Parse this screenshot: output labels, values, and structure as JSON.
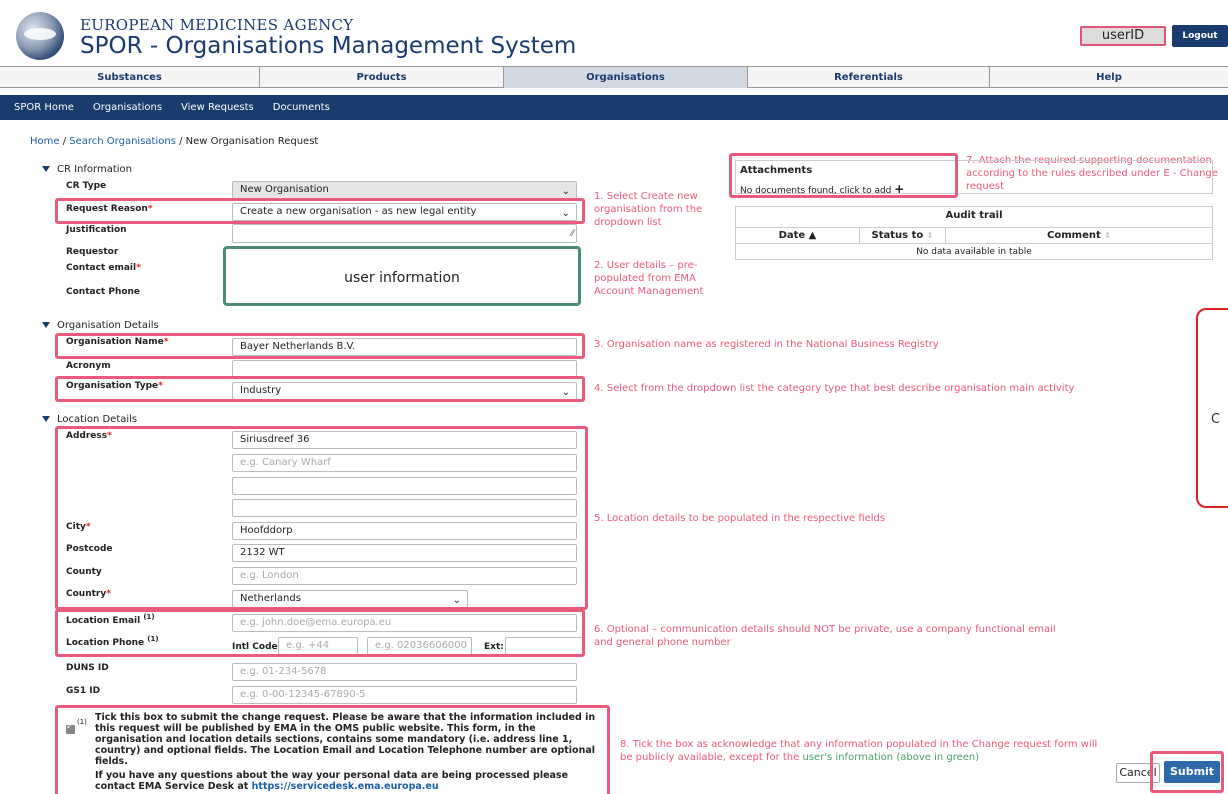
{
  "header": {
    "agency": "EUROPEAN MEDICINES AGENCY",
    "title": "SPOR - Organisations Management System",
    "user_id": "userID",
    "logout": "Logout"
  },
  "tabs": [
    "Substances",
    "Products",
    "Organisations",
    "Referentials",
    "Help"
  ],
  "active_tab": "Organisations",
  "nav": [
    "SPOR Home",
    "Organisations",
    "View Requests",
    "Documents"
  ],
  "breadcrumb": {
    "home": "Home",
    "sep": " / ",
    "search": "Search Organisations",
    "current": "New Organisation Request"
  },
  "cr_information": {
    "heading": "CR Information",
    "cr_type_label": "CR Type",
    "cr_type_value": "New Organisation",
    "request_reason_label": "Request Reason",
    "request_reason_value": "Create a new organisation - as new legal entity",
    "justification_label": "Justification",
    "requestor_label": "Requestor",
    "contact_email_label": "Contact email",
    "contact_phone_label": "Contact Phone",
    "user_information": "user information"
  },
  "organisation_details": {
    "heading": "Organisation Details",
    "name_label": "Organisation Name",
    "name_value": "Bayer Netherlands B.V.",
    "acronym_label": "Acronym",
    "type_label": "Organisation Type",
    "type_value": "Industry"
  },
  "location_details": {
    "heading": "Location Details",
    "address_label": "Address",
    "address_1": "Siriusdreef 36",
    "address_2_placeholder": "e.g. Canary Wharf",
    "city_label": "City",
    "city_value": "Hoofddorp",
    "postcode_label": "Postcode",
    "postcode_value": "2132 WT",
    "county_label": "County",
    "county_placeholder": "e.g. London",
    "country_label": "Country",
    "country_value": "Netherlands",
    "email_label": "Location Email",
    "email_placeholder": "e.g. john.doe@ema.europa.eu",
    "phone_label": "Location Phone",
    "intl_code_label": "Intl Code:",
    "intl_code_placeholder": "e.g. +44",
    "phone_placeholder": "e.g. 02036606000",
    "ext_label": "Ext:",
    "duns_label": "DUNS ID",
    "duns_placeholder": "e.g. 01-234-5678",
    "gs1_label": "GS1 ID",
    "gs1_placeholder": "e.g. 0-00-12345-67890-5",
    "footnote_mark": "(1)"
  },
  "attachments": {
    "title": "Attachments",
    "empty": "No documents found, click to add",
    "plus": "+"
  },
  "audit_trail": {
    "title": "Audit trail",
    "columns": [
      "Date ▲",
      "Status to",
      "Comment"
    ],
    "empty": "No data available in table"
  },
  "notes": {
    "n1": "1. Select Create new organisation from the dropdown list",
    "n2": "2. User details – pre-populated from EMA Account Management",
    "n3": "3. Organisation name as registered in the National Business Registry",
    "n4": "4. Select from the dropdown list the category type that best describe organisation main activity",
    "n5": "5. Location details to be populated in the respective fields",
    "n6": "6. Optional – communication details should NOT be private, use a company functional email and general phone number",
    "n7": "7. Attach the required supporting documentation according to the rules described under E - Change request",
    "n8a": "8. Tick the box as acknowledge that any information populated in the Change request form will be publicly available, except for the ",
    "n8b": "user's information (above in green)"
  },
  "consent": {
    "mark": "(1)",
    "text1": "Tick this box to submit the change request. Please be aware that the information included in this request will be published by EMA in the OMS public website. This form, in the organisation and location details sections, contains some mandatory (i.e. address line 1, country) and optional fields. The Location Email and Location Telephone number are optional fields.",
    "text2": "If you have any questions about the way your personal data are being processed please contact EMA Service Desk at ",
    "link": "https://servicedesk.ema.europa.eu"
  },
  "callout_text": "C",
  "buttons": {
    "cancel": "Cancel",
    "submit": "Submit"
  },
  "colors": {
    "brand": "#1a3b6e",
    "highlight": "#ea5a7a",
    "user_box": "#4a8a7a",
    "submit": "#2e6aaa"
  }
}
